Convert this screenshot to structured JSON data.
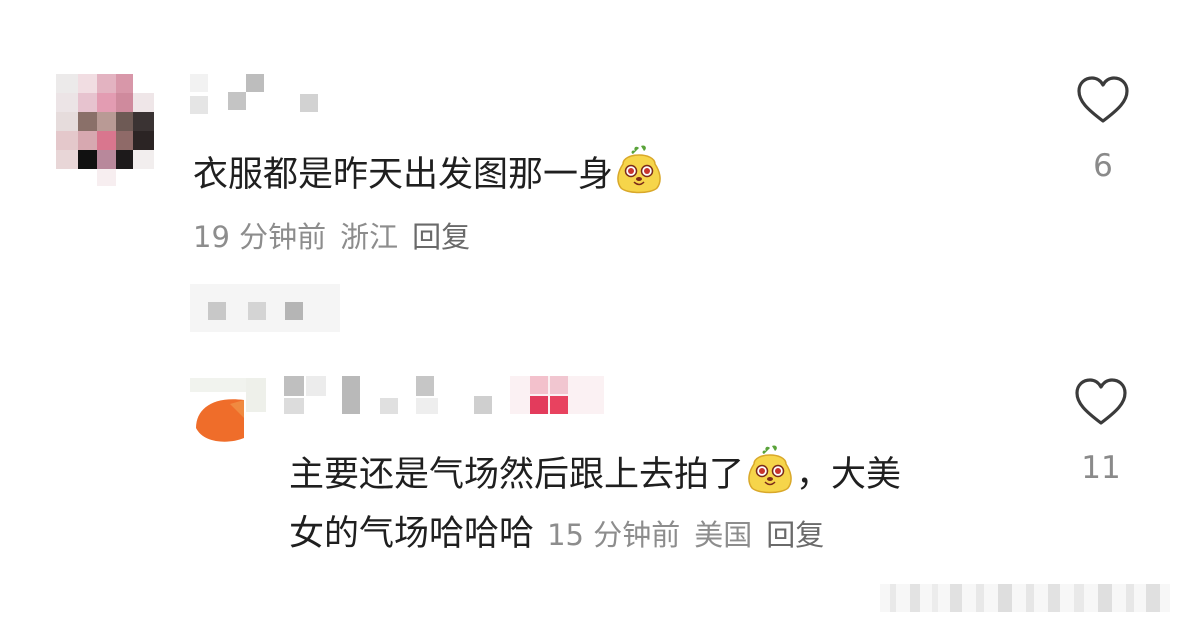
{
  "comments": [
    {
      "text": "衣服都是昨天出发图那一身",
      "time": "19 分钟前",
      "location": "浙江",
      "reply_label": "回复",
      "likes": "6"
    },
    {
      "text_part1": "主要还是气场然后跟上去拍了",
      "text_part2": "，大美",
      "text_part3": "女的气场哈哈哈",
      "time": "15 分钟前",
      "location": "美国",
      "reply_label": "回复",
      "likes": "11"
    }
  ],
  "icons": {
    "like": "heart-outline-icon",
    "emoji": "cute-face-emoji-icon"
  },
  "colors": {
    "text": "#1f1f1f",
    "meta": "#8d8d8d",
    "heart": "#3b3b3b",
    "emoji_face": "#f6d54a",
    "emoji_leaf": "#5aa33a",
    "emoji_eye": "#c8342c"
  }
}
